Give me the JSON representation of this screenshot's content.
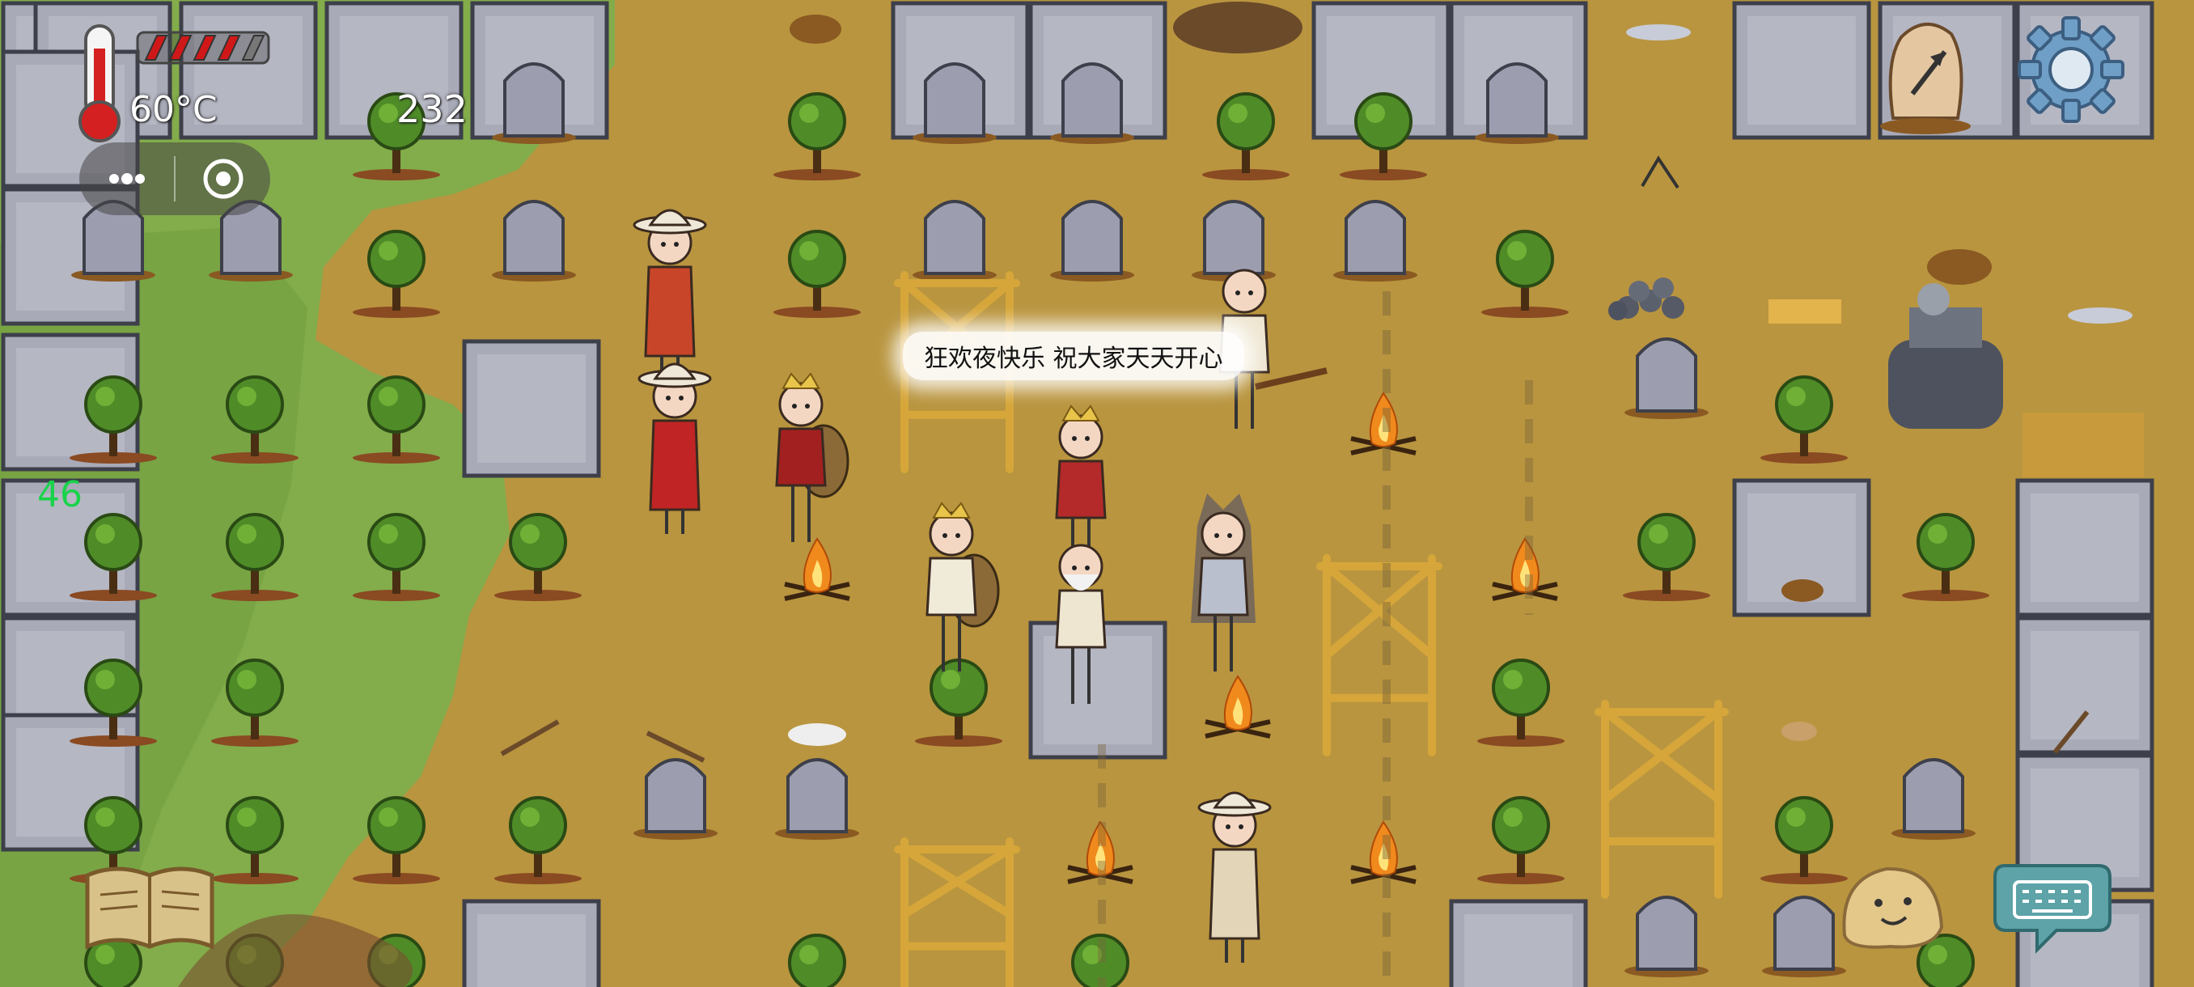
{
  "hud": {
    "temperature": "60°C",
    "score": "232",
    "side_number": "46",
    "food_level": 0.8,
    "icons": {
      "thermometer": "thermometer-icon",
      "food": "food-meter-icon",
      "menu": "more-dots-icon",
      "target": "target-icon",
      "compass": "compass-icon",
      "settings": "gear-icon",
      "book": "book-icon",
      "emote": "smiley-icon",
      "keyboard": "keyboard-icon"
    }
  },
  "chat": {
    "speech": "狂欢夜快乐 祝大家天天开心"
  },
  "colors": {
    "ground": "#b9953f",
    "grass": "#7dae48",
    "stone": "#a9aab8",
    "wood": "#d6a63a",
    "tree": "#4f8c28",
    "fire": "#f08a1c",
    "food_bar": "#d01818"
  }
}
